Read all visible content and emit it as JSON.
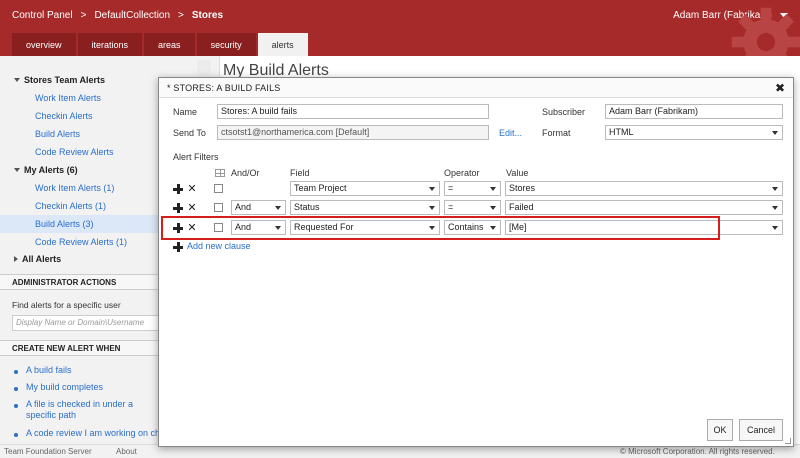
{
  "header": {
    "breadcrumbs": [
      "Control Panel",
      "DefaultCollection",
      "Stores"
    ],
    "separator": ">",
    "user": "Adam Barr (Fabrikam)",
    "tabs": [
      {
        "label": "overview",
        "active": false
      },
      {
        "label": "iterations",
        "active": false
      },
      {
        "label": "areas",
        "active": false
      },
      {
        "label": "security",
        "active": false
      },
      {
        "label": "alerts",
        "active": true
      }
    ],
    "accent_color": "#a72a2a"
  },
  "sidebar": {
    "team_alerts": {
      "title": "Stores Team Alerts",
      "items": [
        "Work Item Alerts",
        "Checkin Alerts",
        "Build Alerts",
        "Code Review Alerts"
      ]
    },
    "my_alerts": {
      "title": "My Alerts (6)",
      "items": [
        "Work Item Alerts (1)",
        "Checkin Alerts (1)",
        "Build Alerts (3)",
        "Code Review Alerts (1)"
      ],
      "selected": "Build Alerts (3)"
    },
    "all_alerts": "All Alerts",
    "admin_section": "ADMINISTRATOR ACTIONS",
    "find_label": "Find alerts for a specific user",
    "find_placeholder": "Display Name or Domain\\Username",
    "create_section": "CREATE NEW ALERT WHEN",
    "create_items": [
      "A build fails",
      "My build completes",
      "A file is checked in under a specific path",
      "A code review I am working on ch"
    ]
  },
  "main": {
    "title": "My Build Alerts"
  },
  "footer": {
    "left": "Team Foundation Server",
    "about": "About",
    "right": "© Microsoft Corporation. All rights reserved."
  },
  "dialog": {
    "title": "* STORES: A BUILD FAILS",
    "name_label": "Name",
    "name_value": "Stores: A build fails",
    "subscriber_label": "Subscriber",
    "subscriber_value": "Adam Barr (Fabrikam)",
    "sendto_label": "Send To",
    "sendto_value": "ctsotst1@northamerica.com [Default]",
    "edit_link": "Edit...",
    "format_label": "Format",
    "format_value": "HTML",
    "filters_label": "Alert Filters",
    "columns": {
      "andor": "And/Or",
      "field": "Field",
      "operator": "Operator",
      "value": "Value"
    },
    "rows": [
      {
        "andor": "",
        "field": "Team Project",
        "operator": "=",
        "value": "Stores"
      },
      {
        "andor": "And",
        "field": "Status",
        "operator": "=",
        "value": "Failed"
      },
      {
        "andor": "And",
        "field": "Requested For",
        "operator": "Contains",
        "value": "[Me]"
      }
    ],
    "add_clause": "Add new clause",
    "ok": "OK",
    "cancel": "Cancel"
  }
}
